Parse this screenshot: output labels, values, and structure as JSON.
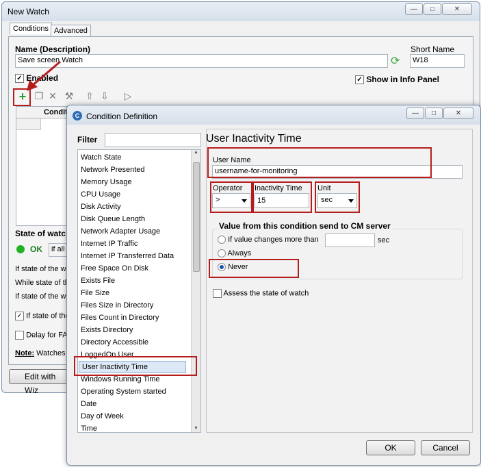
{
  "back_window": {
    "title": "New Watch",
    "tabs": [
      "Conditions",
      "Advanced"
    ],
    "name_label": "Name (Description)",
    "name_value": "Save screen Watch",
    "short_name_label": "Short Name",
    "short_name_value": "W18",
    "enabled_label": "Enabled",
    "show_info_label": "Show in Info Panel",
    "grid_header": "Conditi",
    "state_label": "State of watc",
    "state_ok": "OK",
    "state_if_all": "if all",
    "line1": "If state of the wa",
    "line2": "While state of th",
    "line3": "If state of the wa",
    "check4": "If state of the",
    "check5": "Delay for FA",
    "note_label": "Note:",
    "note_text": "Watches",
    "edit_wizard": "Edit with Wiz"
  },
  "dialog": {
    "title": "Condition Definition",
    "filter_label": "Filter",
    "filter_value": "",
    "heading": "User Inactivity Time",
    "user_name_label": "User Name",
    "user_name_value": "username-for-monitoring",
    "operator_label": "Operator",
    "operator_value": ">",
    "inactivity_label": "Inactivity Time",
    "inactivity_value": "15",
    "unit_label": "Unit",
    "unit_value": "sec",
    "group_label": "Value from this condition send to CM server",
    "opt_changes": "If value changes more than",
    "opt_changes_unit": "sec",
    "opt_always": "Always",
    "opt_never": "Never",
    "assess_label": "Assess the state of watch",
    "ok": "OK",
    "cancel": "Cancel",
    "list": [
      "Watch State",
      "Network Presented",
      "Memory Usage",
      "CPU Usage",
      "Disk Activity",
      "Disk Queue Length",
      "Network Adapter Usage",
      "Internet IP Traffic",
      "Internet IP Transferred Data",
      "Free Space On Disk",
      "Exists File",
      "File Size",
      "Files Size in Directory",
      "Files Count in Directory",
      "Exists Directory",
      "Directory Accessible",
      "LoggedOn User",
      "User Inactivity Time",
      "Windows Running Time",
      "Operating System started",
      "Date",
      "Day of Week",
      "Time"
    ],
    "selected": "User Inactivity Time"
  }
}
